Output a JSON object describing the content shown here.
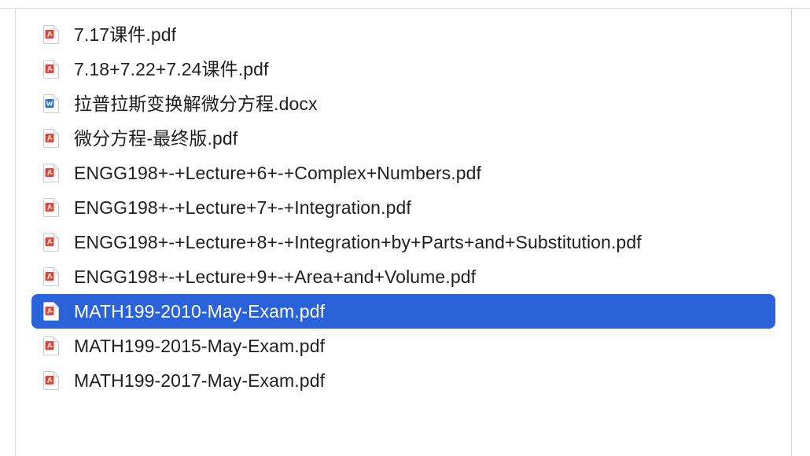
{
  "files": [
    {
      "name": "7.17课件.pdf",
      "icon": "pdf-icon",
      "selected": false
    },
    {
      "name": "7.18+7.22+7.24课件.pdf",
      "icon": "pdf-icon",
      "selected": false
    },
    {
      "name": "拉普拉斯变换解微分方程.docx",
      "icon": "word-icon",
      "selected": false
    },
    {
      "name": "微分方程-最终版.pdf",
      "icon": "pdf-icon",
      "selected": false
    },
    {
      "name": "ENGG198+-+Lecture+6+-+Complex+Numbers.pdf",
      "icon": "pdf-icon",
      "selected": false
    },
    {
      "name": "ENGG198+-+Lecture+7+-+Integration.pdf",
      "icon": "pdf-icon",
      "selected": false
    },
    {
      "name": "ENGG198+-+Lecture+8+-+Integration+by+Parts+and+Substitution.pdf",
      "icon": "pdf-icon",
      "selected": false
    },
    {
      "name": "ENGG198+-+Lecture+9+-+Area+and+Volume.pdf",
      "icon": "pdf-icon",
      "selected": false
    },
    {
      "name": "MATH199-2010-May-Exam.pdf",
      "icon": "pdf-icon",
      "selected": true
    },
    {
      "name": "MATH199-2015-May-Exam.pdf",
      "icon": "pdf-icon",
      "selected": false
    },
    {
      "name": "MATH199-2017-May-Exam.pdf",
      "icon": "pdf-icon",
      "selected": false
    }
  ],
  "colors": {
    "selection": "#2a62d9",
    "pdf_badge": "#d9483b",
    "word_badge": "#2f6fd6"
  }
}
